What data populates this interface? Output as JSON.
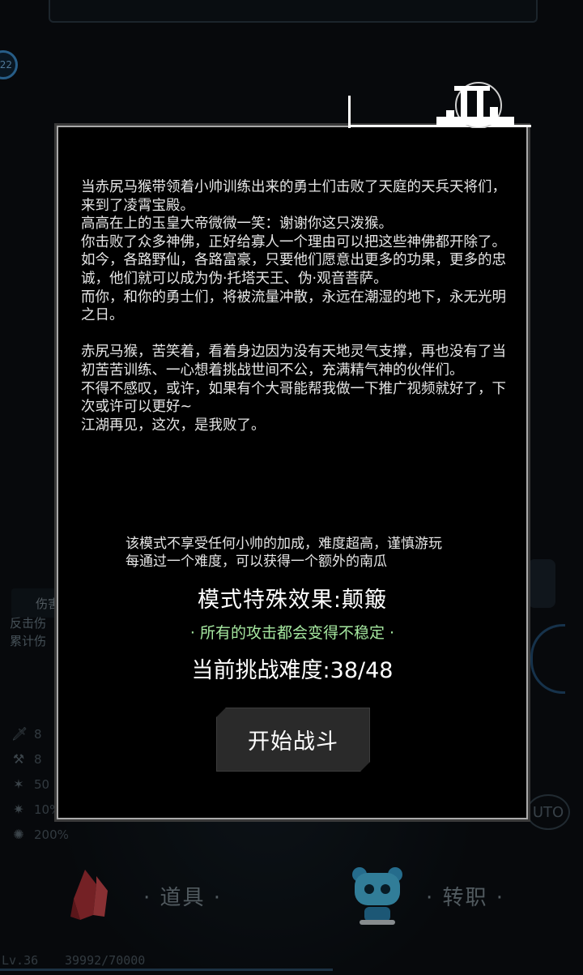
{
  "hud": {
    "level_badge": "22",
    "left_panel": {
      "line1": "伤害",
      "line2": "反击伤",
      "line3": "累计伤"
    },
    "stats": [
      {
        "icon": "sword-icon",
        "value": "8"
      },
      {
        "icon": "axe-icon",
        "value": "8"
      },
      {
        "icon": "slash-icon",
        "value": "50"
      },
      {
        "icon": "critical-icon",
        "value": "10%"
      },
      {
        "icon": "burst-icon",
        "value": "200%"
      }
    ],
    "auto_label": "UTO",
    "bottom_nav": {
      "items_label": "· 道具 ·",
      "job_label": "· 转职 ·"
    },
    "status": {
      "level": "Lv.36",
      "exp": "39992/70000",
      "exp_fraction": 0.571
    }
  },
  "dialog": {
    "story_lines": [
      "当赤尻马猴带领着小帅训练出来的勇士们击败了天庭的天兵天将们，来到了凌霄宝殿。",
      "高高在上的玉皇大帝微微一笑：谢谢你这只泼猴。",
      "你击败了众多神佛，正好给寡人一个理由可以把这些神佛都开除了。",
      "如今，各路野仙，各路富豪，只要他们愿意出更多的功果，更多的忠诚，他们就可以成为伪·托塔天王、伪·观音菩萨。",
      "而你，和你的勇士们，将被流量冲散，永远在潮湿的地下，永无光明之日。",
      "",
      "赤尻马猴，苦笑着，看着身边因为没有天地灵气支撑，再也没有了当初苦苦训练、一心想着挑战世间不公，充满精气神的伙伴们。",
      "不得不感叹，或许，如果有个大哥能帮我做一下推广视频就好了，下次或许可以更好~",
      "江湖再见，这次，是我败了。"
    ],
    "mode_desc_line1": "该模式不享受任何小帅的加成，难度超高，谨慎游玩",
    "mode_desc_line2": "每通过一个难度，可以获得一个额外的南瓜",
    "effect_title": "模式特殊效果:颠簸",
    "effect_desc": "· 所有的攻击都会变得不稳定 ·",
    "difficulty": "当前挑战难度:38/48",
    "start_button": "开始战斗"
  },
  "colors": {
    "effect_green": "#a6e8a0",
    "dialog_bg": "#000000",
    "dialog_border": "#a9a9a9"
  }
}
